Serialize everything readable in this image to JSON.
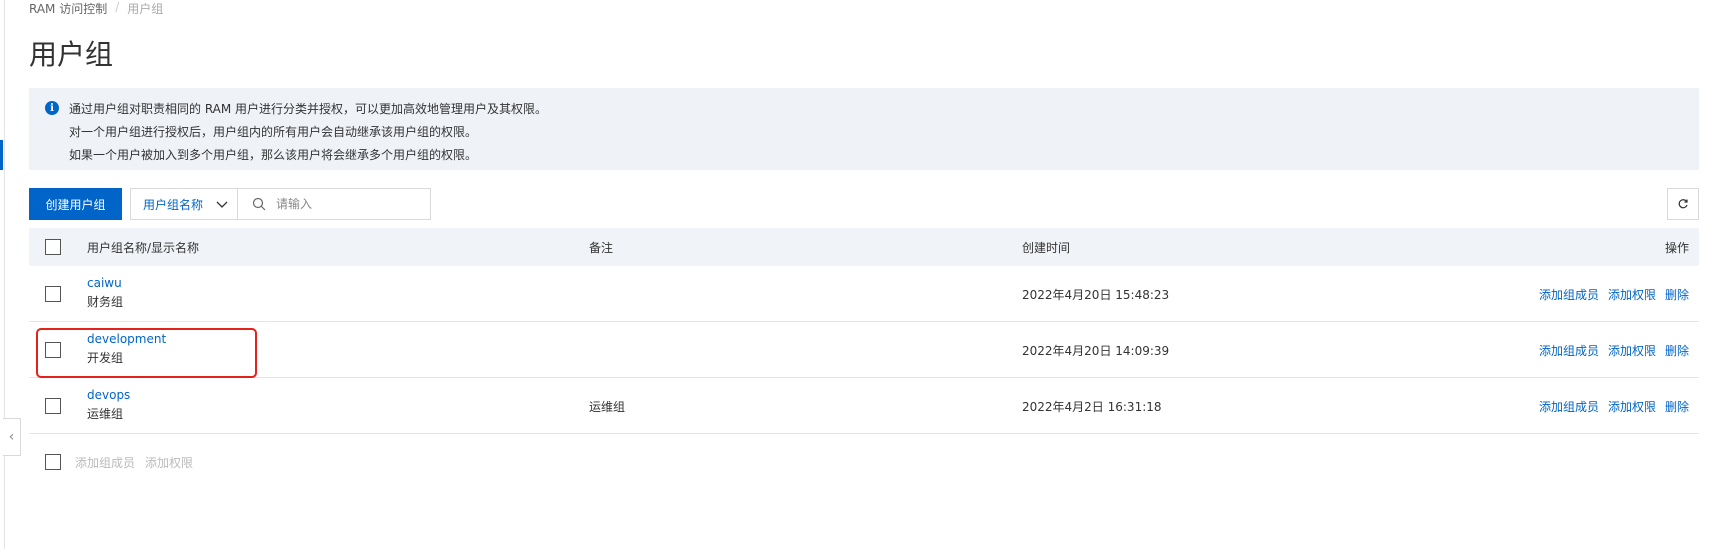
{
  "breadcrumb": {
    "root": "RAM 访问控制",
    "separator": "/",
    "current": "用户组"
  },
  "page_title": "用户组",
  "notice": {
    "icon": "info-icon",
    "lines": [
      "通过用户组对职责相同的 RAM 用户进行分类并授权，可以更加高效地管理用户及其权限。",
      "对一个用户组进行授权后，用户组内的所有用户会自动继承该用户组的权限。",
      "如果一个用户被加入到多个用户组，那么该用户将会继承多个用户组的权限。"
    ]
  },
  "toolbar": {
    "create_label": "创建用户组",
    "filter_selected": "用户组名称",
    "search_placeholder": "请输入"
  },
  "table": {
    "headers": {
      "name": "用户组名称/显示名称",
      "note": "备注",
      "created": "创建时间",
      "ops": "操作"
    },
    "rows": [
      {
        "name": "caiwu",
        "display_name": "财务组",
        "note": "",
        "created": "2022年4月20日 15:48:23"
      },
      {
        "name": "development",
        "display_name": "开发组",
        "note": "",
        "created": "2022年4月20日 14:09:39"
      },
      {
        "name": "devops",
        "display_name": "运维组",
        "note": "运维组",
        "created": "2022年4月2日 16:31:18"
      }
    ],
    "row_ops": {
      "add_member": "添加组成员",
      "add_permission": "添加权限",
      "delete": "删除"
    }
  },
  "batch_actions": {
    "add_member": "添加组成员",
    "add_permission": "添加权限"
  },
  "colors": {
    "accent": "#0064c8",
    "highlight": "#e3231b",
    "notice_bg": "#eff3f8"
  }
}
